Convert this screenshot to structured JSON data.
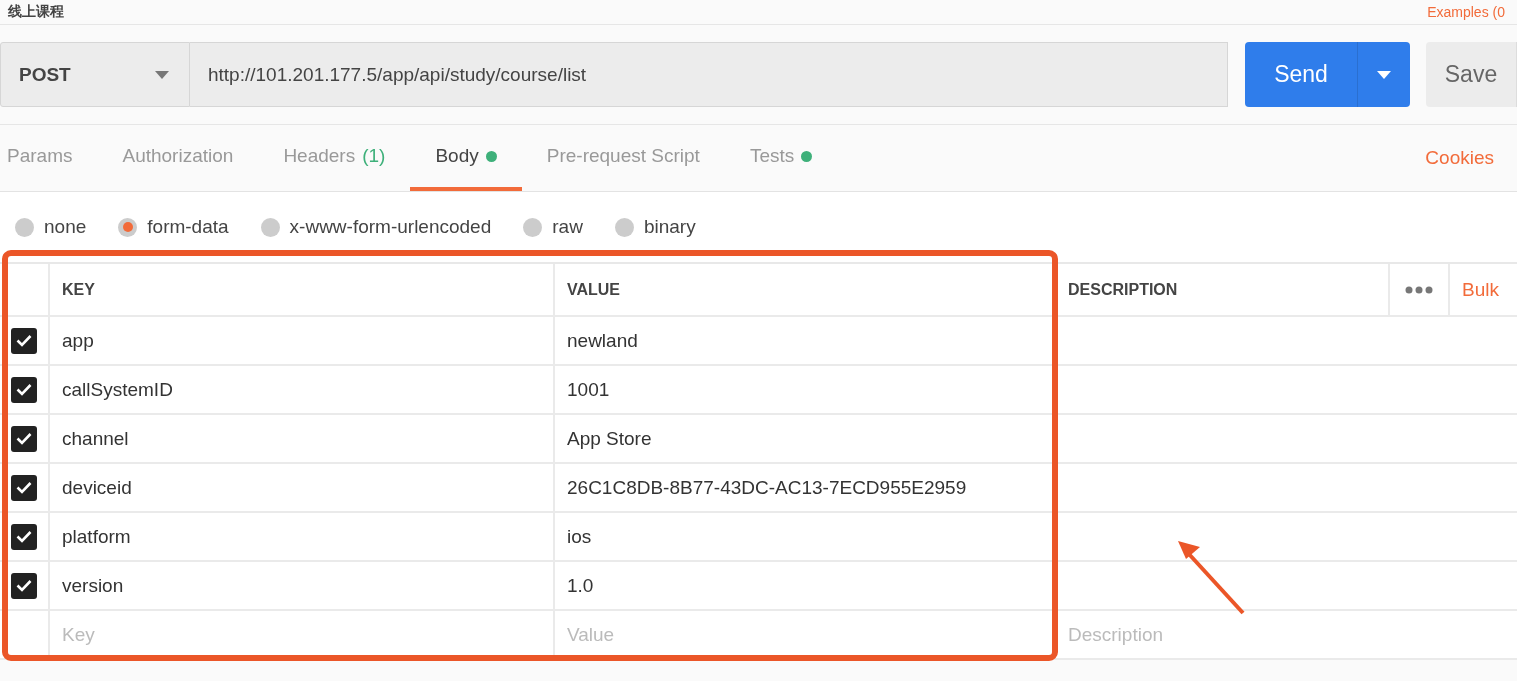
{
  "request_name": "线上课程",
  "examples_link": "Examples (0",
  "request": {
    "method": "POST",
    "url": "http://101.201.177.5/app/api/study/course/list",
    "send": "Send",
    "save": "Save"
  },
  "tabs": [
    {
      "label": "Params",
      "selected": false
    },
    {
      "label": "Authorization",
      "selected": false
    },
    {
      "label": "Headers",
      "count": "(1)",
      "selected": false
    },
    {
      "label": "Body",
      "dot": true,
      "selected": true
    },
    {
      "label": "Pre-request Script",
      "selected": false
    },
    {
      "label": "Tests",
      "dot": true,
      "selected": false
    }
  ],
  "cookies_link": "Cookies",
  "body_types": [
    {
      "label": "none",
      "selected": false
    },
    {
      "label": "form-data",
      "selected": true
    },
    {
      "label": "x-www-form-urlencoded",
      "selected": false
    },
    {
      "label": "raw",
      "selected": false
    },
    {
      "label": "binary",
      "selected": false
    }
  ],
  "table": {
    "columns": [
      "KEY",
      "VALUE",
      "DESCRIPTION"
    ],
    "bulk_edit": "Bulk",
    "rows": [
      {
        "key": "app",
        "value": "newland",
        "checked": true
      },
      {
        "key": "callSystemID",
        "value": "1001",
        "checked": true
      },
      {
        "key": "channel",
        "value": "App Store",
        "checked": true
      },
      {
        "key": "deviceid",
        "value": "26C1C8DB-8B77-43DC-AC13-7ECD955E2959",
        "checked": true
      },
      {
        "key": "platform",
        "value": "ios",
        "checked": true
      },
      {
        "key": "version",
        "value": "1.0",
        "checked": true
      }
    ],
    "new_row": {
      "key_placeholder": "Key",
      "value_placeholder": "Value",
      "description_placeholder": "Description"
    }
  }
}
